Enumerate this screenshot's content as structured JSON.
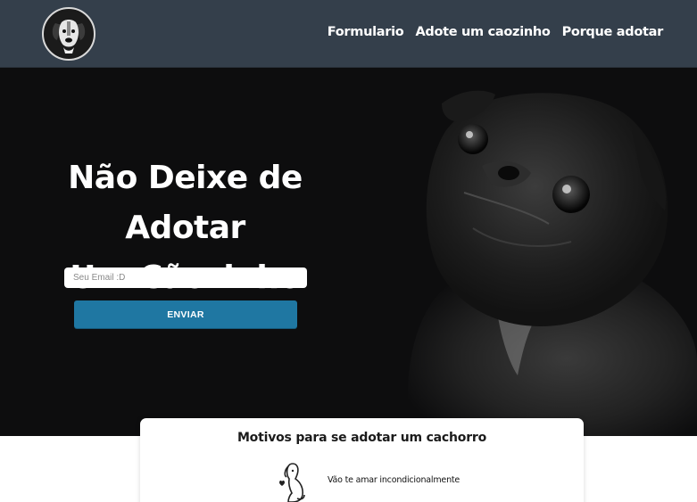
{
  "header": {
    "logo_name": "dog-logo",
    "nav": [
      {
        "label": "Formulario"
      },
      {
        "label": "Adote um caozinho"
      },
      {
        "label": "Porque adotar"
      }
    ],
    "background": "#343f4b"
  },
  "hero": {
    "title_line1": "Não Deixe de Adotar",
    "title_line2": "Um Cãozinho",
    "email_placeholder": "Seu Email :D",
    "button_label": "ENVIAR",
    "button_color": "#1f77a2",
    "background": "#0d0d0e"
  },
  "reasons": {
    "title": "Motivos para se adotar um cachorro",
    "items": [
      {
        "text": "Vão te amar incondicionalmente",
        "icon": "dog-heart-icon"
      }
    ]
  }
}
